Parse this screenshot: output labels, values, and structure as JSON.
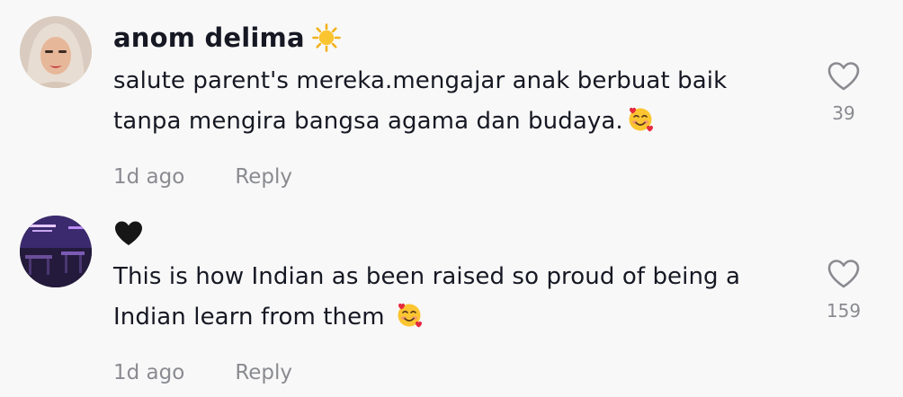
{
  "comments": [
    {
      "username": "anom delima",
      "username_badge_icon": "sun-icon",
      "text": "salute parent's mereka.mengajar anak berbuat baik tanpa mengira bangsa agama dan budaya.",
      "text_emoji_icon": "smiling-face-with-hearts-icon",
      "time": "1d ago",
      "reply_label": "Reply",
      "like_count": "39"
    },
    {
      "username": "",
      "username_badge_icon": "black-heart-icon",
      "text": "This is how Indian as been raised so proud of being a Indian learn from them ",
      "text_emoji_icon": "smiling-face-with-hearts-icon",
      "time": "1d ago",
      "reply_label": "Reply",
      "like_count": "159"
    }
  ],
  "colors": {
    "background": "#f8f8f8",
    "text": "#161823",
    "muted": "#8a8b91"
  }
}
